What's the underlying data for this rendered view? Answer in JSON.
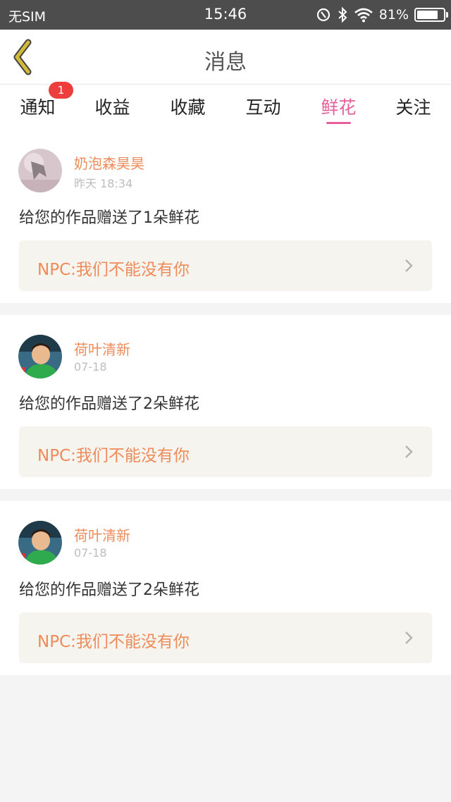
{
  "status_bar": {
    "carrier": "无SIM",
    "time": "15:46",
    "battery_percent_text": "81%",
    "battery_level": 0.81,
    "icons": [
      "nfc-icon",
      "bluetooth-icon",
      "wifi-icon",
      "battery-icon"
    ]
  },
  "header": {
    "title": "消息",
    "back_icon": "chevron-left-icon",
    "accent_color": "#d2b93a"
  },
  "tabs": {
    "active_color": "#e8609a",
    "items": [
      {
        "label": "通知",
        "badge": "1"
      },
      {
        "label": "收益"
      },
      {
        "label": "收藏"
      },
      {
        "label": "互动"
      },
      {
        "label": "鲜花",
        "active": true
      },
      {
        "label": "关注"
      }
    ]
  },
  "messages": [
    {
      "username": "奶泡森昊昊",
      "time": "昨天 18:34",
      "text": "给您的作品赠送了1朵鲜花",
      "work_title": "NPC:我们不能没有你",
      "avatar": "avatar-photo"
    },
    {
      "username": "荷叶清新",
      "time": "07-18",
      "text": "给您的作品赠送了2朵鲜花",
      "work_title": "NPC:我们不能没有你",
      "avatar": "avatar-photo"
    },
    {
      "username": "荷叶清新",
      "time": "07-18",
      "text": "给您的作品赠送了2朵鲜花",
      "work_title": "NPC:我们不能没有你",
      "avatar": "avatar-photo"
    }
  ],
  "colors": {
    "username": "#ef8b5a",
    "badge": "#ee3d3d",
    "card_link_bg": "#f5f4ee"
  }
}
